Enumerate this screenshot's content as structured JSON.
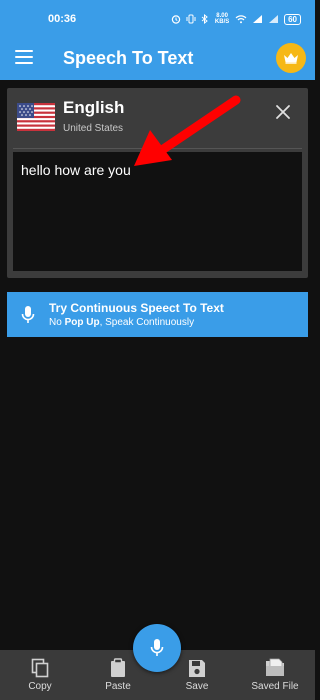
{
  "status_bar": {
    "time": "00:36",
    "network_speed": "8.00 KB/S",
    "battery": "60"
  },
  "app_bar": {
    "title": "Speech To Text",
    "menu_icon": "hamburger-menu-icon",
    "premium_icon": "crown-icon"
  },
  "language": {
    "name": "English",
    "region": "United States",
    "flag_icon": "us-flag-icon"
  },
  "transcript": {
    "text": "hello how are you"
  },
  "banner": {
    "title": "Try Continuous Speect To Text",
    "subtitle_prefix": "No ",
    "subtitle_bold": "Pop Up",
    "subtitle_suffix": ", Speak Continuously"
  },
  "bottom_nav": {
    "items": [
      {
        "label": "Copy",
        "icon": "copy-icon"
      },
      {
        "label": "Paste",
        "icon": "paste-icon"
      },
      {
        "label": "Save",
        "icon": "save-icon"
      },
      {
        "label": "Saved File",
        "icon": "saved-file-icon"
      }
    ]
  },
  "colors": {
    "primary": "#3a9de8",
    "background": "#111111",
    "card": "#3c3c3c",
    "accent_crown": "#f6b817",
    "annotation_arrow": "#ff0000"
  }
}
